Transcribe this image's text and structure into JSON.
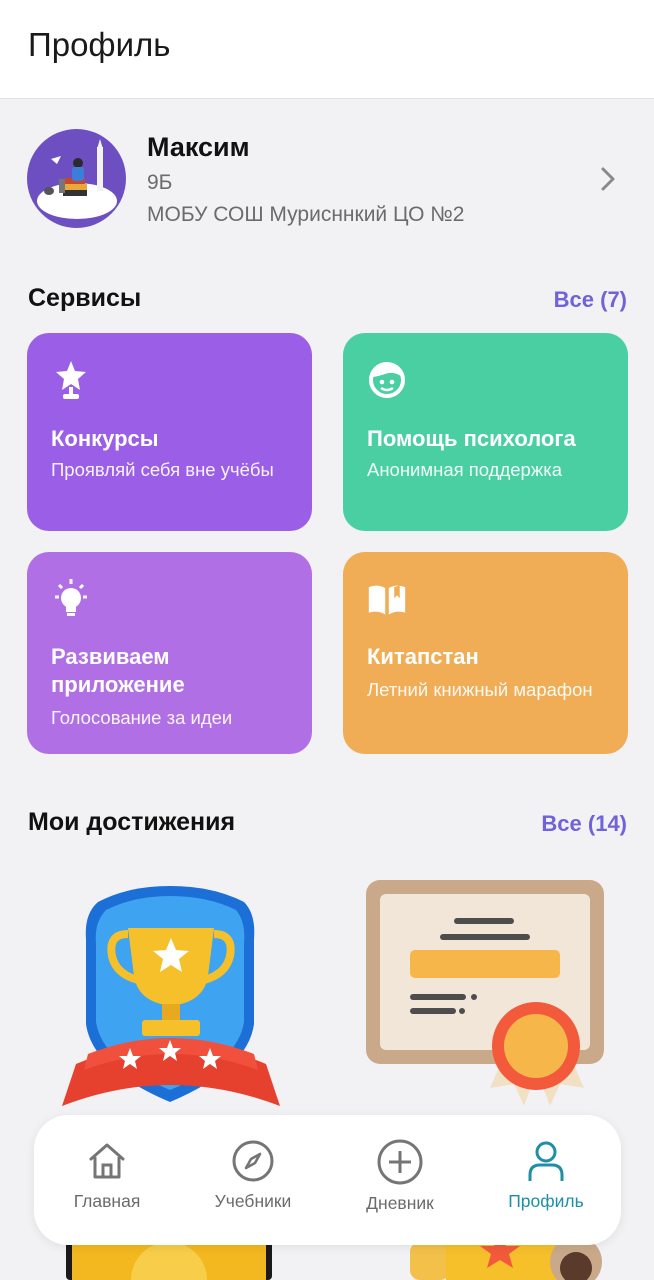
{
  "header": {
    "title": "Профиль"
  },
  "profile": {
    "name": "Максим",
    "grade": "9Б",
    "school": "МОБУ СОШ Мурисннкий ЦО №2"
  },
  "services": {
    "title": "Сервисы",
    "all_link": "Все (7)",
    "items": [
      {
        "name": "Конкурсы",
        "desc": "Проявляй себя вне учёбы",
        "icon": "star-trophy-icon",
        "color": "#9b5ee6"
      },
      {
        "name": "Помощь психолога",
        "desc": "Анонимная поддержка",
        "icon": "headset-face-icon",
        "color": "#49cfa1"
      },
      {
        "name": "Развиваем приложение",
        "desc": "Голосование за идеи",
        "icon": "lightbulb-icon",
        "color": "#b16fe6"
      },
      {
        "name": "Китапстан",
        "desc": "Летний книжный марафон",
        "icon": "open-book-icon",
        "color": "#f0ad55"
      }
    ]
  },
  "achievements": {
    "title": "Мои достижения",
    "all_link": "Все (14)",
    "items": [
      {
        "icon": "trophy-shield-icon"
      },
      {
        "icon": "certificate-icon"
      }
    ]
  },
  "bottom_nav": {
    "items": [
      {
        "label": "Главная",
        "icon": "home-icon",
        "active": false
      },
      {
        "label": "Учебники",
        "icon": "compass-icon",
        "active": false
      },
      {
        "label": "Дневник",
        "icon": "plus-circle-icon",
        "active": false
      },
      {
        "label": "Профиль",
        "icon": "person-icon",
        "active": true
      }
    ],
    "accent": "#1f8fa5"
  },
  "colors": {
    "link": "#6f63d9",
    "background": "#f2f2f4"
  }
}
